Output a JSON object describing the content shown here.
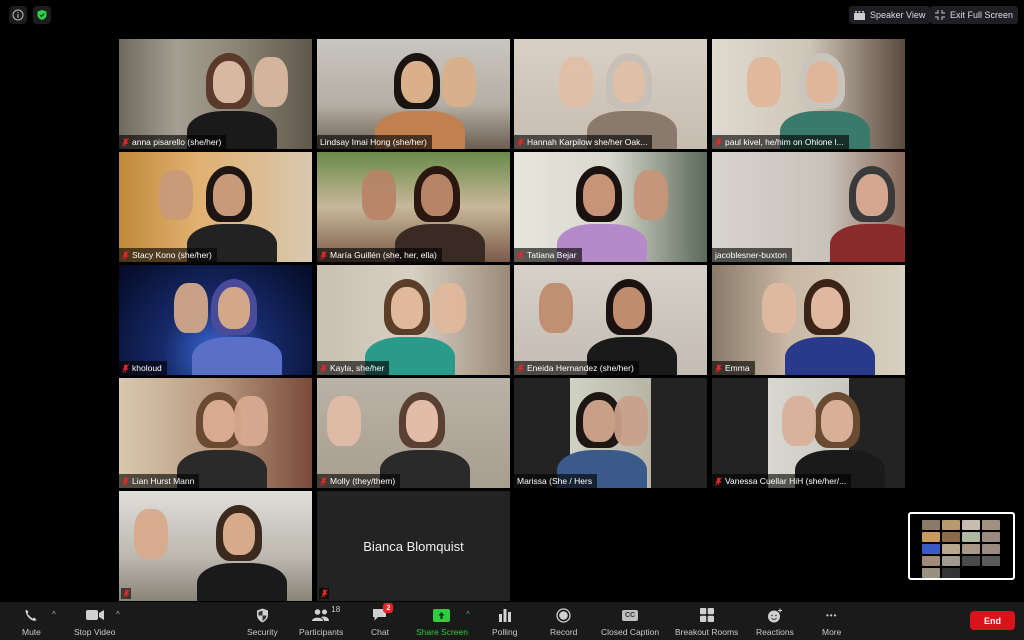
{
  "top_bar": {
    "info_icon": "info-icon",
    "security_icon": "shield-check-icon",
    "speaker_view_label": "Speaker View",
    "exit_fullscreen_label": "Exit Full Screen"
  },
  "participants": [
    {
      "name": "anna pisarello (she/her)",
      "muted": true
    },
    {
      "name": "Lindsay Imai Hong (she/her)",
      "muted": false
    },
    {
      "name": "Hannah Karpilow she/her Oak...",
      "muted": true
    },
    {
      "name": "paul kivel, he/him on Ohlone l...",
      "muted": true
    },
    {
      "name": "Stacy Kono (she/her)",
      "muted": true
    },
    {
      "name": "María Guillén (she, her, ella)",
      "muted": true
    },
    {
      "name": "Tatiana Bejar",
      "muted": true,
      "active_speaker": true
    },
    {
      "name": "jacoblesner-buxton",
      "muted": false
    },
    {
      "name": "kholoud",
      "muted": true
    },
    {
      "name": "Kayla, she/her",
      "muted": true
    },
    {
      "name": "Eneida Hernandez (she/her)",
      "muted": true
    },
    {
      "name": "Emma",
      "muted": true
    },
    {
      "name": "Lian Hurst Mann",
      "muted": true
    },
    {
      "name": "Molly (they/them)",
      "muted": true
    },
    {
      "name": "Marissa (She / Hers",
      "muted": false
    },
    {
      "name": "Vanessa Cuellar HiH (she/her/...",
      "muted": true
    },
    {
      "name": "",
      "muted": true
    },
    {
      "name": "Bianca Blomquist",
      "muted": true,
      "video_off": true
    }
  ],
  "toolbar": {
    "mute_label": "Mute",
    "stop_video_label": "Stop Video",
    "security_label": "Security",
    "participants_label": "Participants",
    "participants_count": "18",
    "chat_label": "Chat",
    "chat_badge": "2",
    "share_screen_label": "Share Screen",
    "polling_label": "Polling",
    "record_label": "Record",
    "closed_caption_label": "Closed Caption",
    "cc_glyph": "CC",
    "breakout_rooms_label": "Breakout Rooms",
    "reactions_label": "Reactions",
    "more_label": "More",
    "more_glyph": "•••",
    "caret_glyph": "^",
    "end_label": "End"
  },
  "colors": {
    "active_speaker_border": "#c5e86c",
    "share_screen_green": "#2ecc40",
    "end_red": "#d9121b",
    "muted_red": "#e02828"
  }
}
